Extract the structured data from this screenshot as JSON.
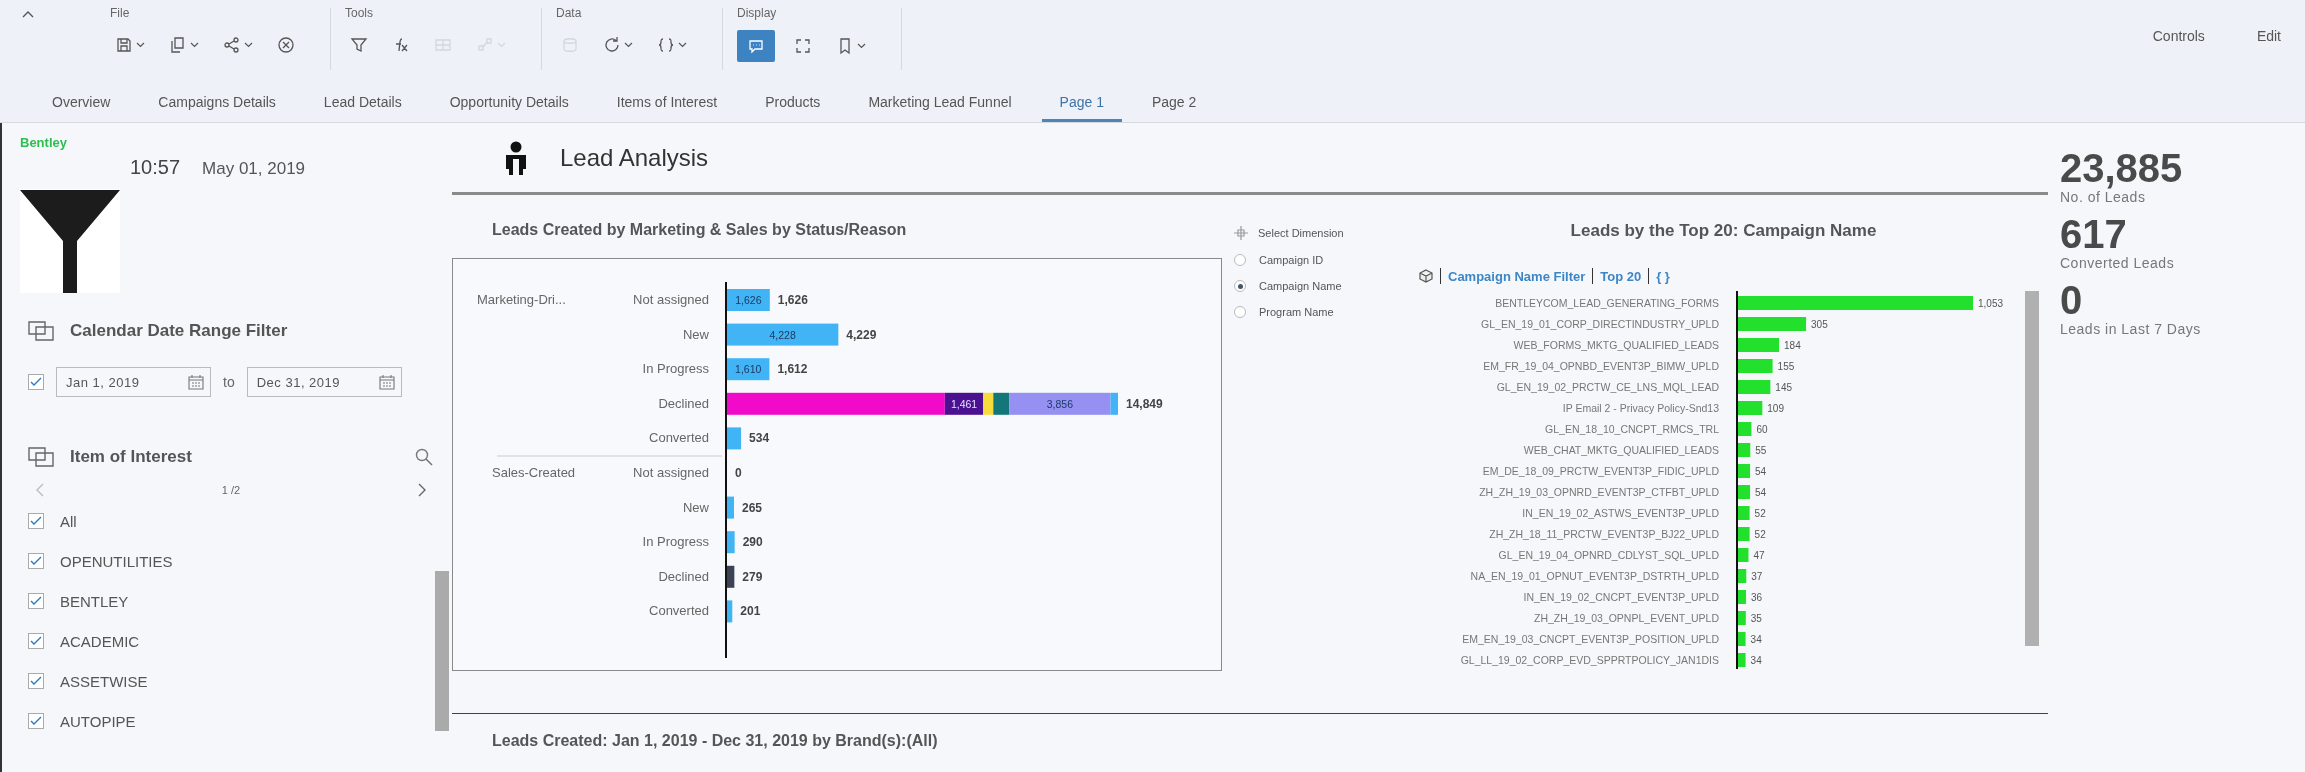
{
  "toolbar": {
    "groups": [
      {
        "label": "File",
        "tools": [
          {
            "has_menu": true,
            "disabled": false,
            "selected": false
          },
          {
            "has_menu": true,
            "disabled": false,
            "selected": false
          },
          {
            "has_menu": true,
            "disabled": false,
            "selected": false
          },
          {
            "has_menu": false,
            "disabled": false,
            "selected": false
          }
        ]
      },
      {
        "label": "Tools",
        "tools": [
          {
            "has_menu": false,
            "disabled": false,
            "selected": false
          },
          {
            "has_menu": false,
            "disabled": false,
            "selected": false
          },
          {
            "has_menu": false,
            "disabled": true,
            "selected": false
          },
          {
            "has_menu": true,
            "disabled": true,
            "selected": false
          }
        ]
      },
      {
        "label": "Data",
        "tools": [
          {
            "has_menu": false,
            "disabled": true,
            "selected": false
          },
          {
            "has_menu": true,
            "disabled": false,
            "selected": false
          },
          {
            "has_menu": true,
            "disabled": false,
            "selected": false
          }
        ]
      },
      {
        "label": "Display",
        "tools": [
          {
            "has_menu": false,
            "disabled": false,
            "selected": true
          },
          {
            "has_menu": false,
            "disabled": false,
            "selected": false
          },
          {
            "has_menu": true,
            "disabled": false,
            "selected": false
          }
        ]
      }
    ],
    "actions": [
      "Controls",
      "Edit"
    ]
  },
  "tabs": [
    {
      "label": "Overview",
      "selected": false
    },
    {
      "label": "Campaigns Details",
      "selected": false
    },
    {
      "label": "Lead Details",
      "selected": false
    },
    {
      "label": "Opportunity Details",
      "selected": false
    },
    {
      "label": "Items of Interest",
      "selected": false
    },
    {
      "label": "Products",
      "selected": false
    },
    {
      "label": "Marketing Lead Funnel",
      "selected": false
    },
    {
      "label": "Page 1",
      "selected": true
    },
    {
      "label": "Page 2",
      "selected": false
    }
  ],
  "sidebar": {
    "logo": "Bentley",
    "time": "10:57",
    "date": "May 01, 2019",
    "date_filter": {
      "title": "Calendar Date Range Filter",
      "checked": true,
      "from": "Jan 1, 2019",
      "separator": "to",
      "to": "Dec 31, 2019"
    },
    "item_filter": {
      "title": "Item of Interest",
      "page": "1 /2",
      "items": [
        {
          "label": "All",
          "checked": true
        },
        {
          "label": "OPENUTILITIES",
          "checked": true
        },
        {
          "label": "BENTLEY",
          "checked": true
        },
        {
          "label": "ACADEMIC",
          "checked": true
        },
        {
          "label": "ASSETWISE",
          "checked": true
        },
        {
          "label": "AUTOPIPE",
          "checked": true
        }
      ]
    }
  },
  "page": {
    "title": "Lead Analysis"
  },
  "status_chart": {
    "title": "Leads Created by Marketing & Sales by Status/Reason",
    "groups": [
      "Marketing-Dri...",
      "Sales-Created"
    ],
    "totals": [
      "1,626",
      "4,229",
      "1,612",
      "14,849",
      "534",
      "0",
      "265",
      "290",
      "279",
      "201"
    ],
    "chart_data": {
      "type": "bar",
      "orientation": "horizontal",
      "stacked": true,
      "categories": [
        "Not assigned",
        "New",
        "In Progress",
        "Declined",
        "Converted",
        "Not assigned",
        "New",
        "In Progress",
        "Declined",
        "Converted"
      ],
      "series": [
        {
          "color": "#f20acb",
          "values": [
            null,
            null,
            null,
            8272,
            null,
            null,
            null,
            null,
            null,
            null
          ]
        },
        {
          "color": "#4a1191",
          "values": [
            null,
            null,
            null,
            1461,
            null,
            null,
            null,
            null,
            null,
            null
          ],
          "value_labels": [
            null,
            null,
            null,
            "1,461",
            null,
            null,
            null,
            null,
            null,
            null
          ]
        },
        {
          "color": "#f5dc3c",
          "values": [
            null,
            null,
            null,
            380,
            null,
            null,
            null,
            null,
            null,
            null
          ]
        },
        {
          "color": "#13777a",
          "values": [
            null,
            null,
            null,
            600,
            null,
            null,
            null,
            null,
            null,
            null
          ]
        },
        {
          "color": "#9590f2",
          "values": [
            null,
            null,
            null,
            3856,
            null,
            null,
            null,
            null,
            null,
            null
          ],
          "value_labels": [
            null,
            null,
            null,
            "3,856",
            null,
            null,
            null,
            null,
            null,
            null
          ]
        },
        {
          "color": "#41b4f5",
          "values": [
            1626,
            4228,
            1610,
            280,
            534,
            0,
            265,
            290,
            null,
            201
          ],
          "value_labels": [
            "1,626",
            "4,228",
            "1,610",
            null,
            null,
            null,
            null,
            null,
            null,
            null
          ]
        },
        {
          "color": "#3c4256",
          "values": [
            null,
            null,
            null,
            null,
            null,
            null,
            null,
            null,
            279,
            null
          ]
        }
      ]
    }
  },
  "dimension_selector": {
    "title": "Select Dimension",
    "options": [
      {
        "label": "Campaign ID",
        "selected": false
      },
      {
        "label": "Campaign Name",
        "selected": true
      },
      {
        "label": "Program Name",
        "selected": false
      }
    ]
  },
  "campaign_chart": {
    "title": "Leads by the Top 20:  Campaign Name",
    "filters": [
      "Campaign Name Filter",
      "Top 20",
      "{ }"
    ],
    "chart_data": {
      "type": "bar",
      "orientation": "horizontal",
      "categories": [
        "BENTLEYCOM_LEAD_GENERATING_FORMS",
        "GL_EN_19_01_CORP_DIRECTINDUSTRY_UPLD",
        "WEB_FORMS_MKTG_QUALIFIED_LEADS",
        "EM_FR_19_04_OPNBD_EVENT3P_BIMW_UPLD",
        "GL_EN_19_02_PRCTW_CE_LNS_MQL_LEAD",
        "IP Email 2 - Privacy Policy-Snd13",
        "GL_EN_18_10_CNCPT_RMCS_TRL",
        "WEB_CHAT_MKTG_QUALIFIED_LEADS",
        "EM_DE_18_09_PRCTW_EVENT3P_FIDIC_UPLD",
        "ZH_ZH_19_03_OPNRD_EVENT3P_CTFBT_UPLD",
        "IN_EN_19_02_ASTWS_EVENT3P_UPLD",
        "ZH_ZH_18_11_PRCTW_EVENT3P_BJ22_UPLD",
        "GL_EN_19_04_OPNRD_CDLYST_SQL_UPLD",
        "NA_EN_19_01_OPNUT_EVENT3P_DSTRTH_UPLD",
        "IN_EN_19_02_CNCPT_EVENT3P_UPLD",
        "ZH_ZH_19_03_OPNPL_EVENT_UPLD",
        "EM_EN_19_03_CNCPT_EVENT3P_POSITION_UPLD",
        "GL_LL_19_02_CORP_EVD_SPPRTPOLICY_JAN1DIS"
      ],
      "series": [
        {
          "color": "#22e02c",
          "values": [
            1053,
            305,
            184,
            155,
            145,
            109,
            60,
            55,
            54,
            54,
            52,
            52,
            47,
            37,
            36,
            35,
            34,
            34
          ],
          "value_labels": [
            "1,053",
            "305",
            "184",
            "155",
            "145",
            "109",
            "60",
            "55",
            "54",
            "54",
            "52",
            "52",
            "47",
            "37",
            "36",
            "35",
            "34",
            "34"
          ]
        }
      ]
    }
  },
  "kpis": [
    {
      "value": "23,885",
      "label": "No. of Leads"
    },
    {
      "value": "617",
      "label": "Converted Leads"
    },
    {
      "value": "0",
      "label": "Leads in Last 7 Days"
    }
  ],
  "footer": {
    "title": "Leads Created: Jan 1, 2019 - Dec 31, 2019 by Brand(s):(All)"
  }
}
